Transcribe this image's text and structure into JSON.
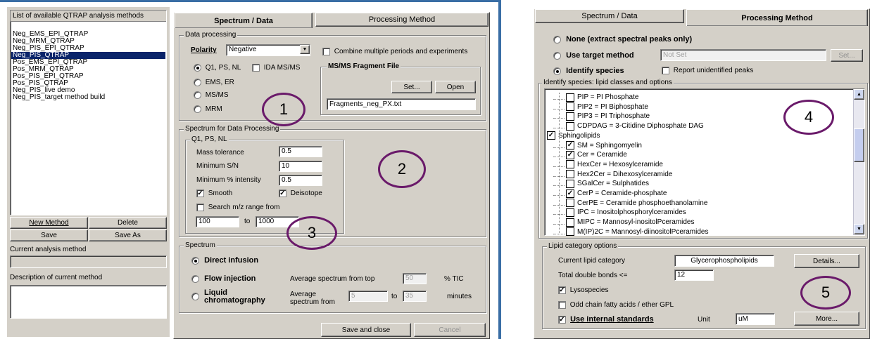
{
  "left_panel": {
    "methods_list_header": "List of available QTRAP analysis methods",
    "methods": [
      "Neg_EMS_EPI_QTRAP",
      "Neg_MRM_QTRAP",
      "Neg_PIS_EPI_QTRAP",
      "Neg_PIS_QTRAP",
      "Pos_EMS_EPI_QTRAP",
      "Pos_MRM_QTRAP",
      "Pos_PIS_EPI_QTRAP",
      "Pos_PIS_QTRAP",
      "Neg_PIS_live demo",
      "Neg_PIS_target method build"
    ],
    "selected_method": "Neg_PIS_QTRAP",
    "buttons": {
      "new_method": "New Method",
      "delete": "Delete",
      "save": "Save",
      "save_as": "Save As"
    },
    "current_method_label": "Current analysis method",
    "current_method_value": "",
    "description_label": "Description of current method",
    "description_value": ""
  },
  "main_tabs": {
    "spectrum_data": "Spectrum / Data",
    "processing_method": "Processing Method"
  },
  "data_processing": {
    "title": "Data processing",
    "polarity_label": "Polarity",
    "polarity_value": "Negative",
    "combine_label": "Combine multiple periods and experiments",
    "combine_checked": false,
    "modes": [
      {
        "label": "Q1, PS, NL",
        "selected": true
      },
      {
        "label": "EMS, ER",
        "selected": false
      },
      {
        "label": "MS/MS",
        "selected": false
      },
      {
        "label": "MRM",
        "selected": false
      }
    ],
    "ida_label": "IDA MS/MS",
    "ida_checked": false,
    "fragment_file": {
      "title": "MS/MS Fragment File",
      "set": "Set...",
      "open": "Open",
      "value": "Fragments_neg_PX.txt"
    }
  },
  "spectrum_processing": {
    "title": "Spectrum for Data Processing",
    "subgroup": "Q1, PS, NL",
    "mass_tolerance_label": "Mass tolerance",
    "mass_tolerance": "0.5",
    "min_sn_label": "Minimum S/N",
    "min_sn": "10",
    "min_intensity_label": "Minimum % intensity",
    "min_intensity": "0.5",
    "smooth_label": "Smooth",
    "smooth_checked": true,
    "deisotope_label": "Deisotope",
    "deisotope_checked": true,
    "search_range_label": "Search m/z range from",
    "search_range_checked": false,
    "range_from": "100",
    "range_to_label": "to",
    "range_to": "1000"
  },
  "spectrum": {
    "title": "Spectrum",
    "direct_infusion": "Direct infusion",
    "flow_injection": "Flow injection",
    "avg_from_top_label": "Average spectrum from top",
    "avg_from_top": "50",
    "tic_unit": "% TIC",
    "liquid_chrom": "Liquid chromatography",
    "avg_from_label": "Average spectrum from",
    "avg_from": "5",
    "avg_to_label": "to",
    "avg_to": "35",
    "minutes_unit": "minutes",
    "selected": "direct_infusion"
  },
  "bottom_buttons": {
    "save_close": "Save and close",
    "cancel": "Cancel"
  },
  "processing_method": {
    "none_label": "None (extract spectral peaks only)",
    "target_label": "Use target method",
    "target_value": "Not Set",
    "target_set": "Set...",
    "identify_label": "Identify species",
    "report_unidentified": "Report unidentified peaks",
    "report_checked": false,
    "selected": "identify",
    "lipid_group_title": "Identify species: lipid classes and options",
    "tree": [
      {
        "label": "PIP = PI Phosphate",
        "checked": false,
        "level": 1
      },
      {
        "label": "PIP2 = PI Biphosphate",
        "checked": false,
        "level": 1
      },
      {
        "label": "PIP3 = PI Triphosphate",
        "checked": false,
        "level": 1
      },
      {
        "label": "CDPDAG = 3-Citidine Diphosphate DAG",
        "checked": false,
        "level": 1
      },
      {
        "label": "Sphingolipids",
        "checked": true,
        "level": 0
      },
      {
        "label": "SM = Sphingomyelin",
        "checked": true,
        "level": 1
      },
      {
        "label": "Cer = Ceramide",
        "checked": true,
        "level": 1
      },
      {
        "label": "HexCer = Hexosylceramide",
        "checked": false,
        "level": 1
      },
      {
        "label": "Hex2Cer = Dihexosylceramide",
        "checked": false,
        "level": 1
      },
      {
        "label": "SGalCer = Sulphatides",
        "checked": false,
        "level": 1
      },
      {
        "label": "CerP = Ceramide-phosphate",
        "checked": true,
        "level": 1
      },
      {
        "label": "CerPE = Ceramide phosphoethanolamine",
        "checked": false,
        "level": 1
      },
      {
        "label": "IPC = Inositolphosphorylceramides",
        "checked": false,
        "level": 1
      },
      {
        "label": "MIPC = Mannosyl-inositolPceramides",
        "checked": false,
        "level": 1
      },
      {
        "label": "M(IP)2C = Mannosyl-diinositolPceramides",
        "checked": false,
        "level": 1
      }
    ],
    "category_group_title": "Lipid category options",
    "current_category_label": "Current lipid category",
    "current_category": "Glycerophospholipids",
    "details": "Details...",
    "double_bonds_label": "Total double bonds <=",
    "double_bonds": "12",
    "lysospecies_label": "Lysospecies",
    "lysospecies_checked": true,
    "odd_chain_label": "Odd chain fatty acids / ether GPL",
    "odd_chain_checked": false,
    "internal_std_label": "Use internal standards",
    "internal_std_checked": true,
    "unit_label": "Unit",
    "unit_value": "uM",
    "more": "More..."
  },
  "annotations": [
    "1",
    "2",
    "3",
    "4",
    "5"
  ]
}
